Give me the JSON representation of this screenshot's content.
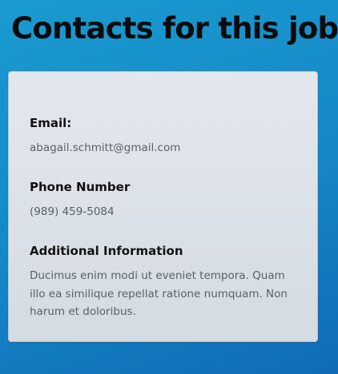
{
  "page": {
    "title": "Contacts for this job"
  },
  "card": {
    "email": {
      "label": "Email:",
      "value": "abagail.schmitt@gmail.com"
    },
    "phone": {
      "label": "Phone Number",
      "value": "(989) 459-5084"
    },
    "additional": {
      "label": "Additional Information",
      "value": "Ducimus enim modi ut eveniet tempora. Quam illo ea similique repellat ratione numquam. Non harum et doloribus."
    }
  }
}
